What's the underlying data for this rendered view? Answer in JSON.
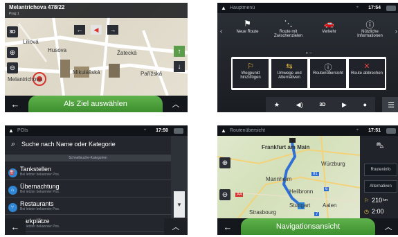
{
  "screen1": {
    "street_name": "Melantrichova 478/22",
    "street_sub": "Prag 1",
    "mode_3d": "3D",
    "map_labels": [
      "Liliová",
      "Husova",
      "Žatecká",
      "Mikulášská",
      "Pařížská",
      "Melantrichova"
    ],
    "main_button": "Als Ziel auswählen",
    "icons": {
      "back": "back-arrow-icon",
      "up": "chevron-up-icon",
      "zoom_in": "zoom-in-icon",
      "zoom_out": "zoom-out-icon"
    }
  },
  "screen2": {
    "title": "Hauptmenü",
    "time": "17:54",
    "items": [
      {
        "label": "Neue Route",
        "icon": "checkered-flag-icon"
      },
      {
        "label": "Route mit Zwischenzielen",
        "icon": "waypoints-icon"
      },
      {
        "label": "Verkehr",
        "icon": "car-icon"
      },
      {
        "label": "Nützliche Informationen",
        "icon": "info-icon"
      }
    ],
    "sub_items": [
      {
        "label": "Wegpunkt hinzufügen",
        "icon": "add-waypoint-icon"
      },
      {
        "label": "Umwege und Alternativen",
        "icon": "detour-icon"
      },
      {
        "label": "Routenübersicht",
        "icon": "route-overview-icon"
      },
      {
        "label": "Route abbrechen",
        "icon": "cancel-route-icon"
      }
    ],
    "quick": {
      "mode": "3D"
    }
  },
  "screen3": {
    "title": "POIs",
    "time": "17:50",
    "search_placeholder": "Suche nach Name oder Kategorie",
    "section": "Schnellsuche-Kategorien",
    "items": [
      {
        "name": "Tankstellen",
        "sub": "Bei letzter bekannter Pos."
      },
      {
        "name": "Übernachtung",
        "sub": "Bei letzter bekannter Pos."
      },
      {
        "name": "Restaurants",
        "sub": "Bei letzter bekannter Pos."
      },
      {
        "name": "Parkplätze",
        "sub": "Bei letzter bekannter Pos."
      }
    ]
  },
  "screen4": {
    "title": "Routenübersicht",
    "time": "17:51",
    "map_labels": [
      "Frankfurt am Main",
      "Würzburg",
      "Mannheim",
      "Heilbronn",
      "Stuttgart",
      "Aalen",
      "Strasbourg",
      "A4",
      "81",
      "6",
      "7"
    ],
    "route_info_button": "Routeninfo",
    "alternatives_button": "Alternativen",
    "distance": "210",
    "distance_unit": "km",
    "duration": "2:00",
    "main_button": "Navigationsansicht"
  }
}
